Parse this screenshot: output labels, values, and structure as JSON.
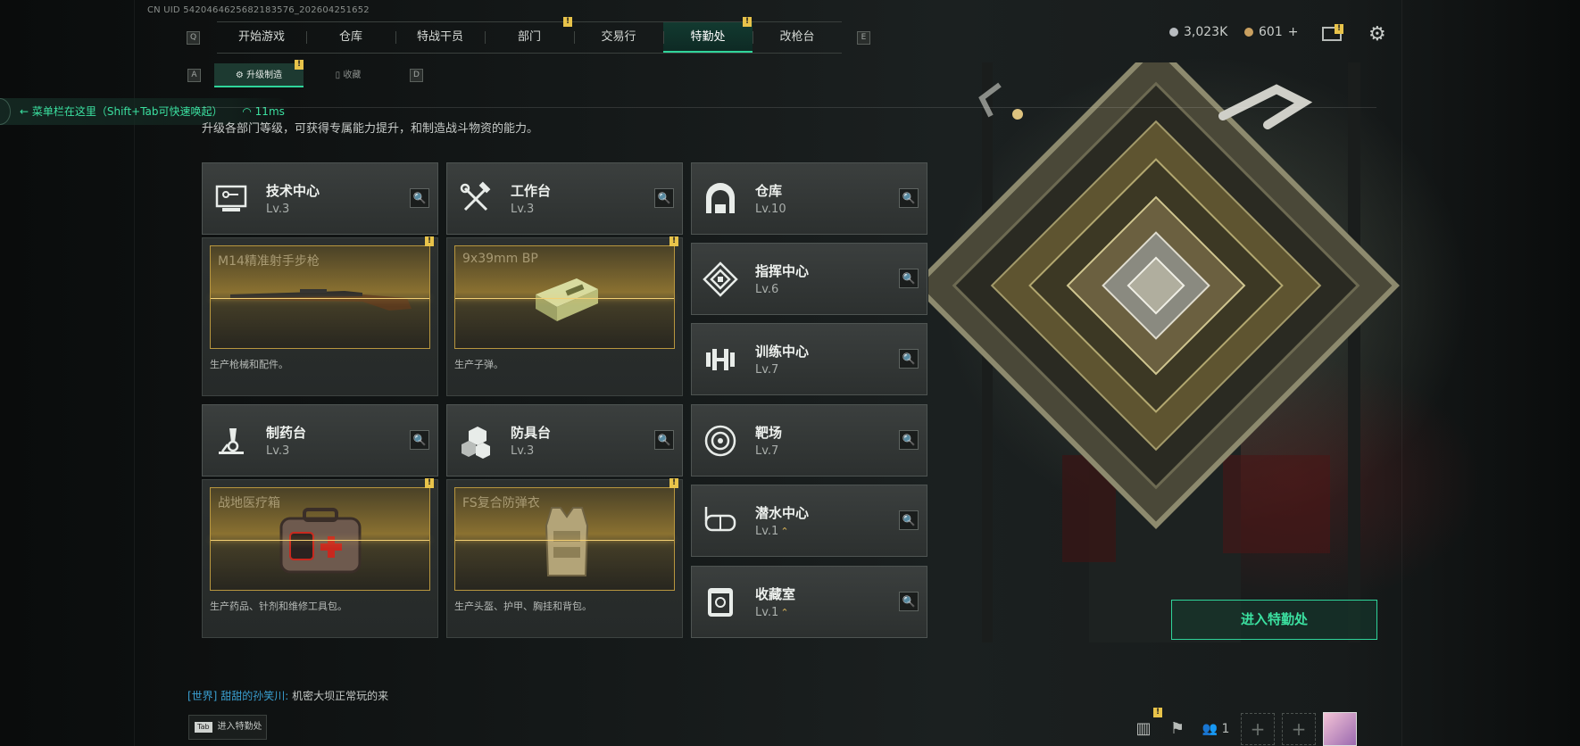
{
  "uid_text": "CN UID 5420464625682183576_202604251652",
  "top_nav": {
    "left_key": "Q",
    "right_key": "E",
    "tabs": [
      {
        "label": "开始游戏",
        "active": false
      },
      {
        "label": "仓库",
        "active": false
      },
      {
        "label": "特战干员",
        "active": false
      },
      {
        "label": "部门",
        "active": false,
        "alert": true
      },
      {
        "label": "交易行",
        "active": false
      },
      {
        "label": "特勤处",
        "active": true,
        "alert": true
      },
      {
        "label": "改枪台",
        "active": false
      }
    ]
  },
  "sub_nav": {
    "left_key": "A",
    "right_key": "D",
    "tabs": [
      {
        "label": "升级制造",
        "active": true
      },
      {
        "label": "收藏",
        "active": false
      }
    ]
  },
  "hud": {
    "currency1": "3,023K",
    "currency2": "601",
    "plus": "+"
  },
  "menu_hint": {
    "text": "菜单栏在这里（Shift+Tab可快速唤起）",
    "ping": "11ms"
  },
  "description": "升级各部门等级，可获得专属能力提升，和制造战斗物资的能力。",
  "facilities": {
    "tech_center": {
      "name": "技术中心",
      "level": "Lv.3",
      "icon": "monitor-icon"
    },
    "workbench": {
      "name": "工作台",
      "level": "Lv.3",
      "icon": "tools-icon"
    },
    "pharmacy": {
      "name": "制药台",
      "level": "Lv.3",
      "icon": "microscope-icon"
    },
    "armor_bench": {
      "name": "防具台",
      "level": "Lv.3",
      "icon": "cubes-icon"
    },
    "warehouse": {
      "name": "仓库",
      "level": "Lv.10",
      "icon": "warehouse-icon"
    },
    "command_center": {
      "name": "指挥中心",
      "level": "Lv.6",
      "icon": "chip-icon"
    },
    "training_center": {
      "name": "训练中心",
      "level": "Lv.7",
      "icon": "dumbbell-icon"
    },
    "range": {
      "name": "靶场",
      "level": "Lv.7",
      "icon": "target-icon"
    },
    "diving_center": {
      "name": "潜水中心",
      "level": "Lv.1",
      "icon": "goggles-icon",
      "upgrade": "⌃"
    },
    "collection_room": {
      "name": "收藏室",
      "level": "Lv.1",
      "icon": "vault-icon",
      "upgrade": "⌃"
    }
  },
  "productions": {
    "tech": {
      "title": "M14精准射手步枪",
      "desc": "生产枪械和配件。"
    },
    "workbench": {
      "title": "9x39mm BP",
      "desc": "生产子弹。"
    },
    "pharmacy": {
      "title": "战地医疗箱",
      "desc": "生产药品、针剂和维修工具包。"
    },
    "armor": {
      "title": "FS复合防弹衣",
      "desc": "生产头盔、护甲、胸挂和背包。"
    }
  },
  "enter_button": "进入特勤处",
  "chat": {
    "channel": "[世界]",
    "user": "甜甜的孙笑川:",
    "message": "机密大坝正常玩的来"
  },
  "tab_hint": {
    "key": "Tab",
    "label": "进入特勤处"
  },
  "friends_count": "1",
  "colors": {
    "accent": "#2fd49a",
    "gold": "#d9b35a",
    "alert": "#e8c34a"
  }
}
